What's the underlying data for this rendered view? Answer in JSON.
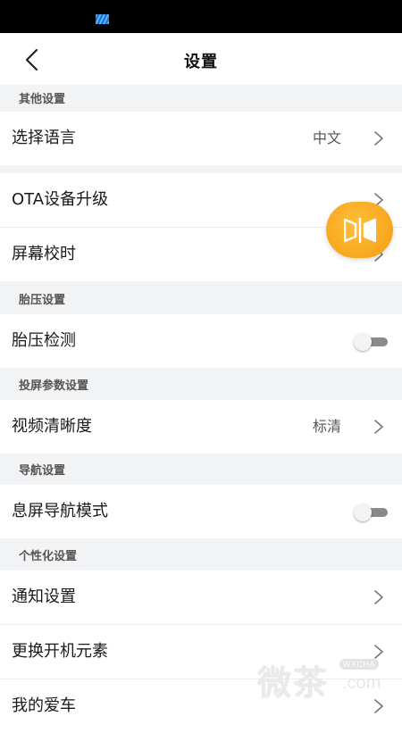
{
  "header": {
    "title": "设置"
  },
  "sections": {
    "other": {
      "title": "其他设置",
      "language": {
        "label": "选择语言",
        "value": "中文"
      },
      "ota": {
        "label": "OTA设备升级"
      },
      "screen_time": {
        "label": "屏幕校时"
      }
    },
    "tire": {
      "title": "胎压设置",
      "tire_detect": {
        "label": "胎压检测",
        "enabled": false
      }
    },
    "projection": {
      "title": "投屏参数设置",
      "video_quality": {
        "label": "视频清晰度",
        "value": "标清"
      }
    },
    "navigation": {
      "title": "导航设置",
      "screen_off_nav": {
        "label": "息屏导航模式",
        "enabled": false
      }
    },
    "personal": {
      "title": "个性化设置",
      "notifications": {
        "label": "通知设置"
      },
      "boot_elements": {
        "label": "更换开机元素"
      },
      "my_car": {
        "label": "我的爱车"
      }
    }
  },
  "watermark": {
    "text": "微茶",
    "badge": "WXCHA",
    "domain": ".com"
  },
  "colors": {
    "accent_orange": "#f7a01a",
    "background": "#f2f3f5",
    "toggle_off": "#8a8a8a"
  }
}
